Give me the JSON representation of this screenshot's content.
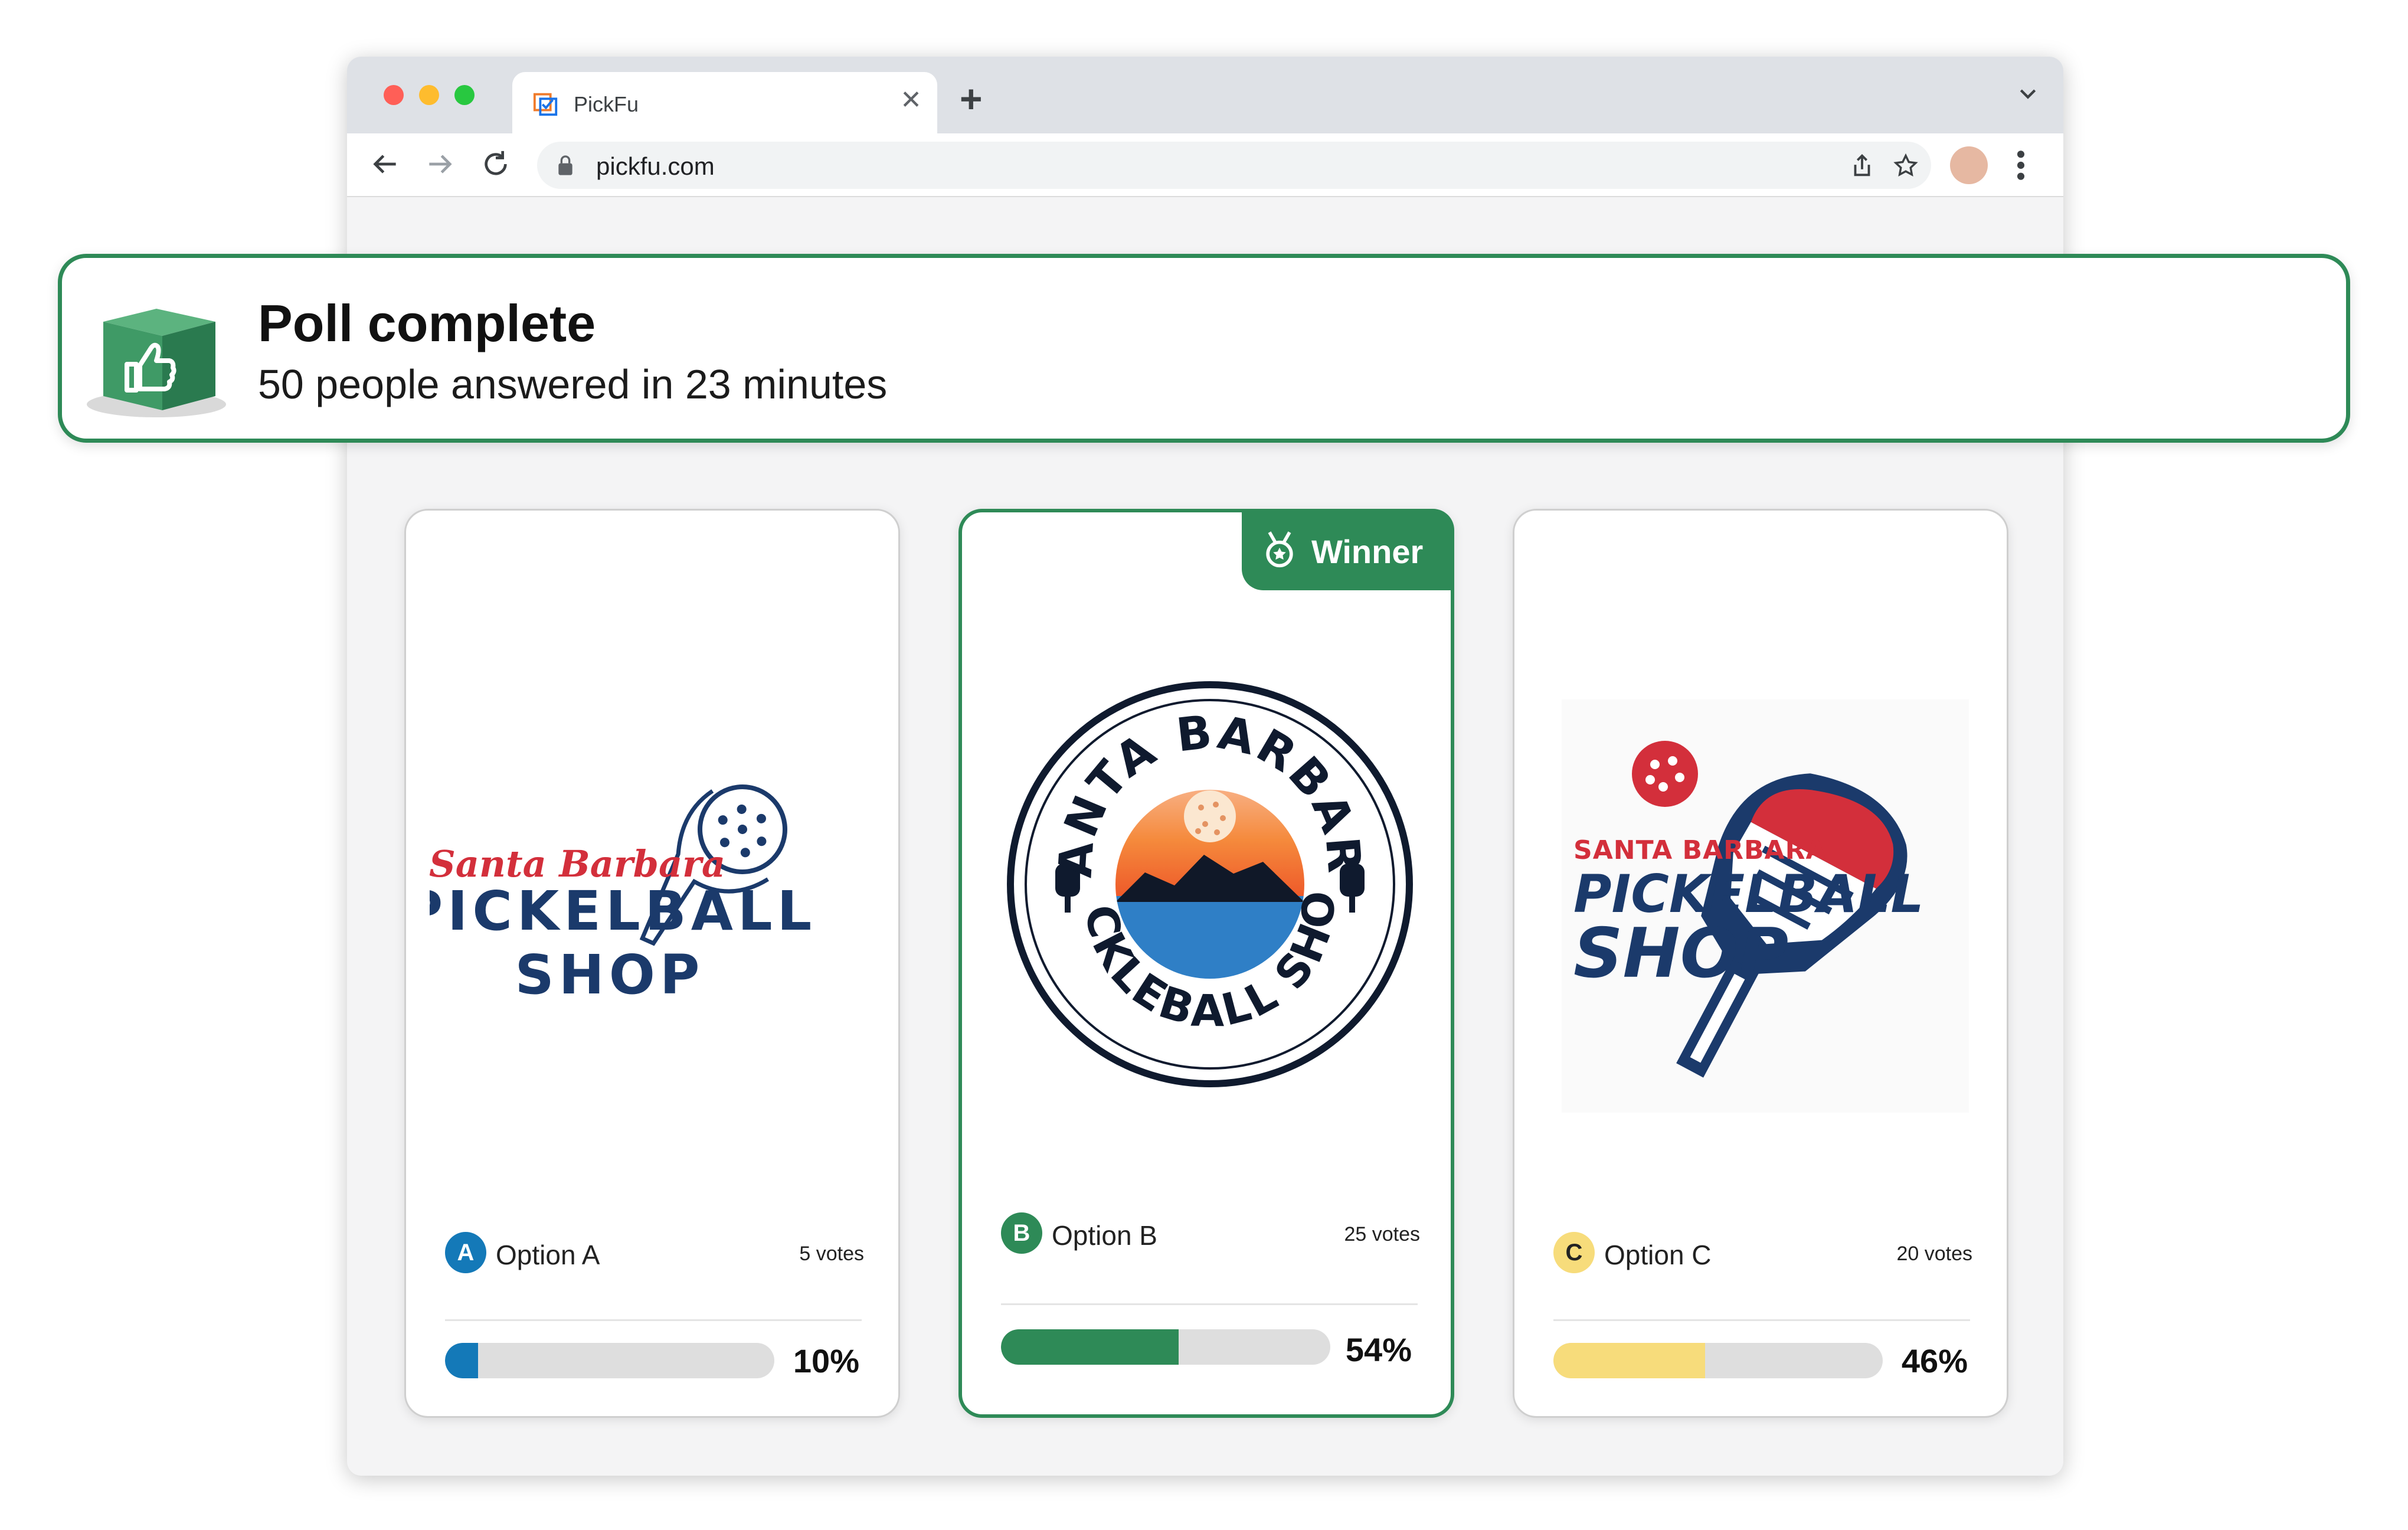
{
  "browser": {
    "tab_title": "PickFu",
    "url": "pickfu.com"
  },
  "banner": {
    "title": "Poll complete",
    "subtitle": "50 people answered in 23 minutes"
  },
  "options": [
    {
      "letter": "A",
      "label": "Option A",
      "votes": "5 votes",
      "percent": "10%",
      "share": 0.1,
      "color": "#1479b8",
      "badge_text_color": "#ffffff",
      "winner": false
    },
    {
      "letter": "B",
      "label": "Option B",
      "votes": "25 votes",
      "percent": "54%",
      "share": 0.54,
      "color": "#2e8a57",
      "badge_text_color": "#ffffff",
      "winner": true
    },
    {
      "letter": "C",
      "label": "Option C",
      "votes": "20 votes",
      "percent": "46%",
      "share": 0.46,
      "color": "#f7dc7b",
      "badge_text_color": "#222222",
      "winner": false
    }
  ],
  "winner_label": "Winner",
  "logos": {
    "a": {
      "line1": "Santa Barbara",
      "line2": "PICKELBALL",
      "line3": "SHOP"
    },
    "b": {
      "line1": "SANTA BARBARA",
      "line2": "PICKLEBALL SHOP"
    },
    "c": {
      "line1": "SANTA BARBARA",
      "line2": "PICKELBALL",
      "line3": "SHOP"
    }
  },
  "colors": {
    "accent": "#2e8a57",
    "navy": "#1b3a6b",
    "red": "#d32f3b"
  }
}
